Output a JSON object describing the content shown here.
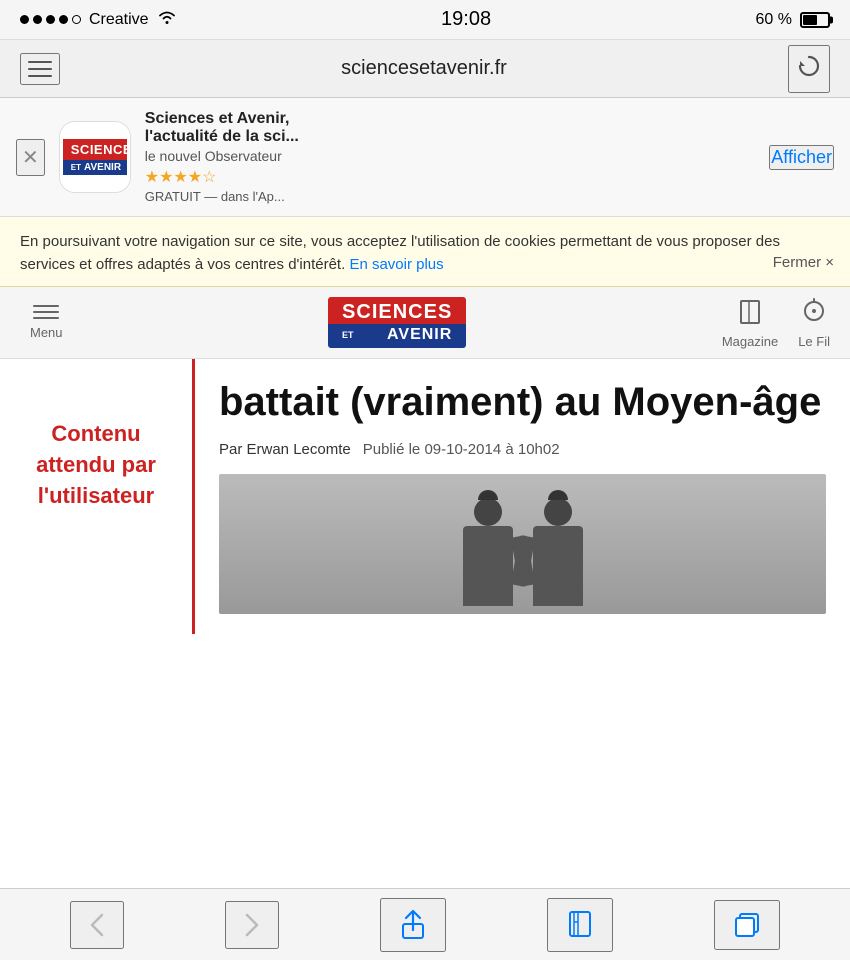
{
  "status_bar": {
    "carrier": "Creative",
    "time": "19:08",
    "battery_percent": "60 %",
    "signal_dots": 4,
    "signal_empty": 1
  },
  "address_bar": {
    "url": "sciencesetavenir.fr"
  },
  "app_banner": {
    "title": "Sciences et Avenir,",
    "title2": "l'actualité de la sci...",
    "subtitle": "le nouvel Observateur",
    "stars": "★★★★☆",
    "free_label": "GRATUIT — dans l'Ap...",
    "action_label": "Afficher"
  },
  "cookie_banner": {
    "text": "En poursuivant votre navigation sur ce site, vous acceptez l'utilisation de cookies permettant de vous proposer des services et offres adaptés à vos centres d'intérêt.",
    "link_text": "En savoir plus",
    "close_label": "Fermer ×"
  },
  "site_nav": {
    "menu_label": "Menu",
    "magazine_label": "Magazine",
    "fil_label": "Le Fil"
  },
  "article": {
    "title": "battait (vraiment) au Moyen-âge",
    "author": "Par Erwan Lecomte",
    "published": "Publié le 09-10-2014 à 10h02"
  },
  "annotation": {
    "text": "Contenu attendu par l'utilisateur"
  },
  "bottom_toolbar": {
    "back_label": "‹",
    "forward_label": "›"
  }
}
